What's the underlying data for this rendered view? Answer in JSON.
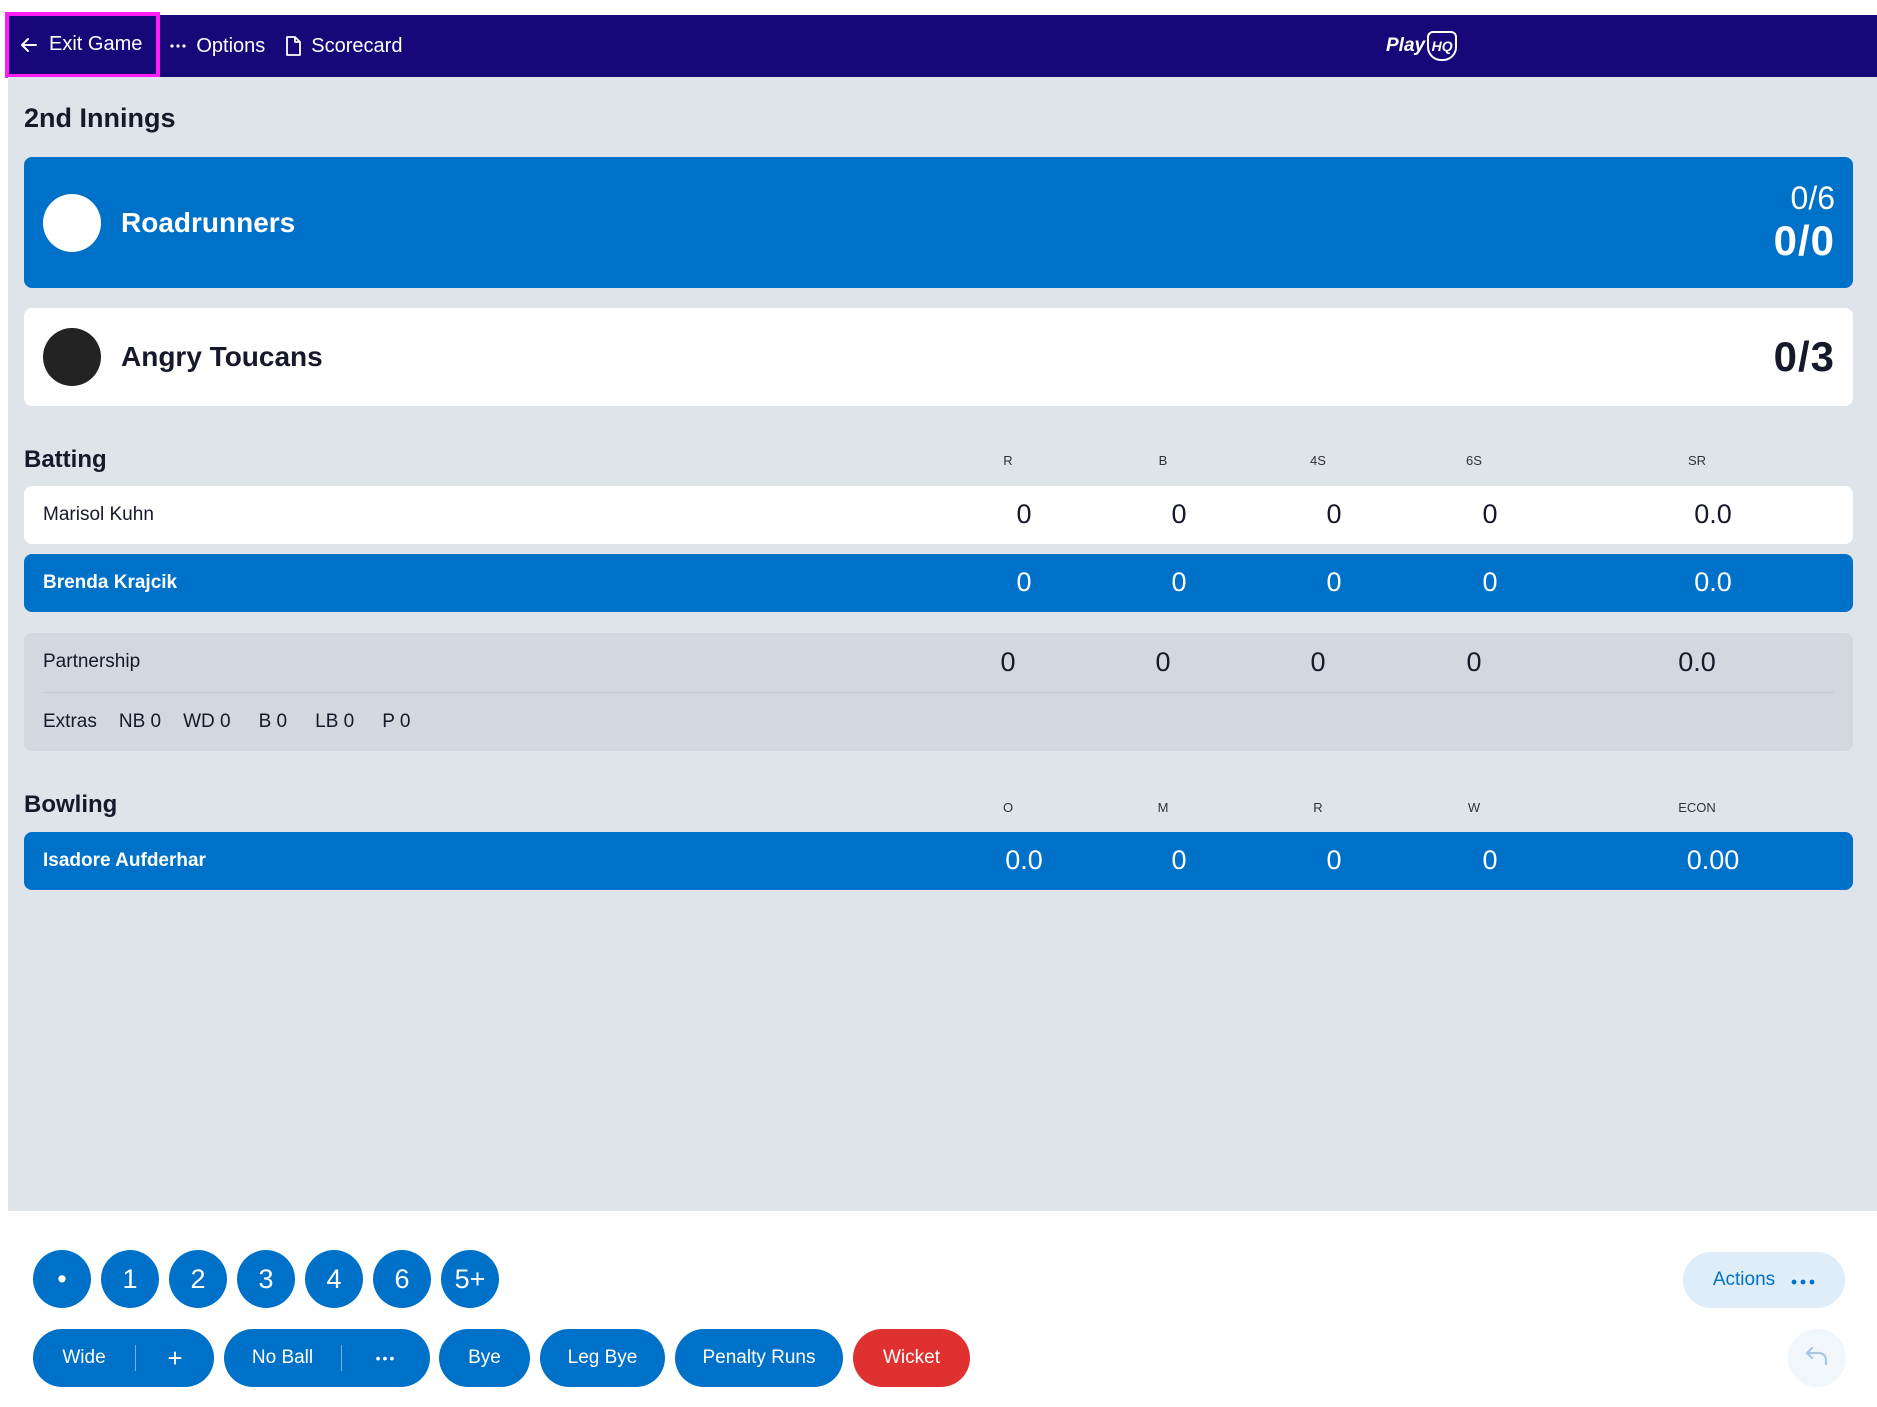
{
  "topbar": {
    "exit_label": "Exit Game",
    "options_label": "Options",
    "scorecard_label": "Scorecard",
    "brand_text": "Play",
    "brand_badge": "HQ"
  },
  "innings_title": "2nd Innings",
  "batting_team": {
    "name": "Roadrunners",
    "overs": "0/6",
    "score": "0/0"
  },
  "fielding_team": {
    "name": "Angry Toucans",
    "score": "0/3"
  },
  "batting": {
    "title": "Batting",
    "headers": [
      "R",
      "B",
      "4S",
      "6S",
      "SR"
    ],
    "rows": [
      {
        "name": "Marisol Kuhn",
        "values": [
          "0",
          "0",
          "0",
          "0",
          "0.0"
        ]
      },
      {
        "name": "Brenda Krajcik",
        "values": [
          "0",
          "0",
          "0",
          "0",
          "0.0"
        ]
      }
    ],
    "partnership": {
      "label": "Partnership",
      "values": [
        "0",
        "0",
        "0",
        "0",
        "0.0"
      ]
    },
    "extras": {
      "label": "Extras",
      "nb": "NB 0",
      "wd": "WD 0",
      "b": "B 0",
      "lb": "LB 0",
      "p": "P 0"
    }
  },
  "bowling": {
    "title": "Bowling",
    "headers": [
      "O",
      "M",
      "R",
      "W",
      "ECON"
    ],
    "rows": [
      {
        "name": "Isadore Aufderhar",
        "values": [
          "0.0",
          "0",
          "0",
          "0",
          "0.00"
        ]
      }
    ]
  },
  "controls": {
    "runs": [
      "•",
      "1",
      "2",
      "3",
      "4",
      "6",
      "5+"
    ],
    "wide_label": "Wide",
    "wide_extra": "+",
    "noball_label": "No Ball",
    "noball_extra": "•••",
    "bye_label": "Bye",
    "legbye_label": "Leg Bye",
    "penalty_label": "Penalty Runs",
    "wicket_label": "Wicket",
    "actions_label": "Actions",
    "actions_icon": "•••"
  },
  "colors": {
    "topbar": "#170879",
    "primary": "#0071c8",
    "wicket": "#e03131",
    "highlight": "#ff1cf5",
    "panel": "#dfe3ea"
  }
}
